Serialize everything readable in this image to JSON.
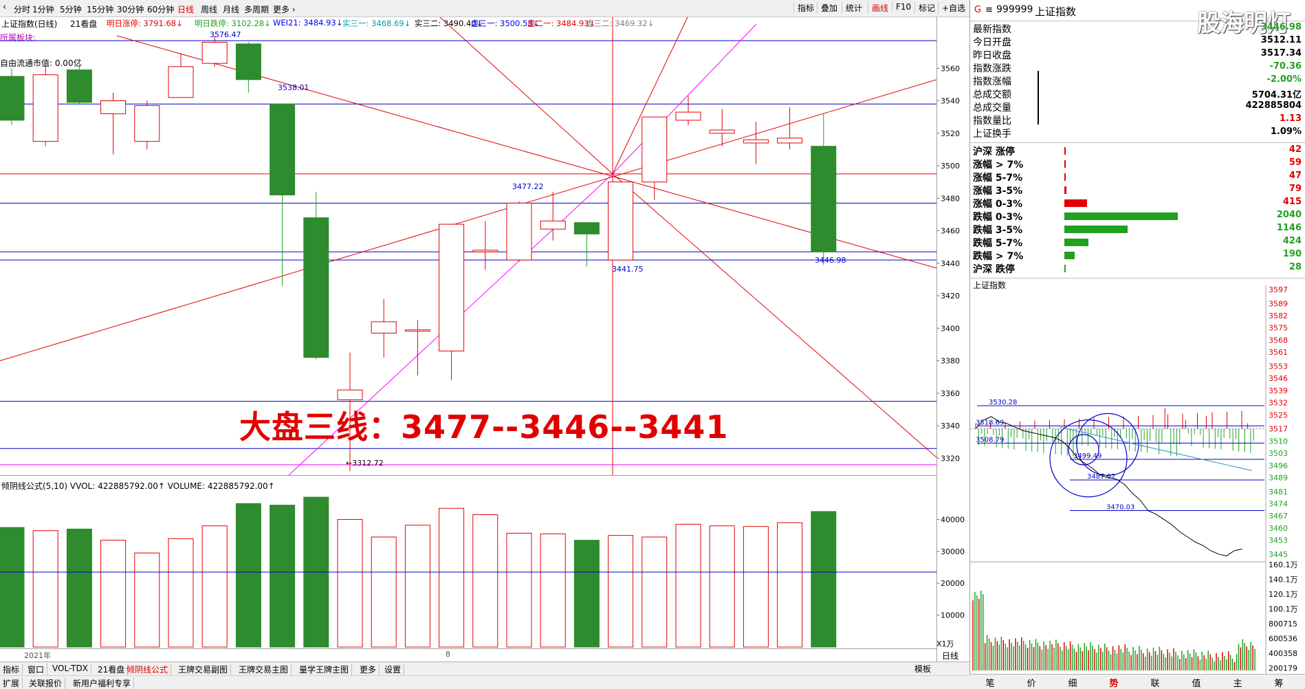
{
  "toolbar": {
    "periods": [
      "分时",
      "1分钟",
      "5分钟",
      "15分钟",
      "30分钟",
      "60分钟",
      "日线",
      "周线",
      "月线",
      "多周期",
      "更多 ›"
    ],
    "selected": "日线",
    "right_buttons": [
      "指标",
      "叠加",
      "统计",
      "画线",
      "F10",
      "标记",
      "+自选"
    ],
    "right_selected": "画线"
  },
  "info_line": {
    "title": "上证指数(日线)",
    "view": "21看盘",
    "items": [
      {
        "label": "明日涨停: 3791.68↓",
        "color": "#e00000"
      },
      {
        "label": "明日跌停: 3102.28↓",
        "color": "#22a022"
      },
      {
        "label": "WEI21: 3484.93↓",
        "color": "#0000ee"
      },
      {
        "label": "实三一: 3468.69↓",
        "color": "#00a0a0"
      },
      {
        "label": "实三二: 3490.40↓",
        "color": "#000000"
      },
      {
        "label": "虚三一: 3500.53↓",
        "color": "#0000ee"
      },
      {
        "label": "虚二一: 3484.93↓",
        "color": "#e00000"
      },
      {
        "label": "虚三二: 3469.32↓",
        "color": "#808080"
      }
    ]
  },
  "side_labels": {
    "block": "所属板块:",
    "float_value": "自由流通市值: 0.00亿"
  },
  "price_labels": {
    "high": "3576.47",
    "p1": "3538.01",
    "p2": "3477.22",
    "p3": "3441.75",
    "p4": "3446.98",
    "low": "←3312.72"
  },
  "headline": "大盘三线：3477--3446--3441",
  "chart_data": {
    "type": "candlestick",
    "title": "上证指数(日线)",
    "ylim": [
      3310,
      3580
    ],
    "y_ticks": [
      3320,
      3340,
      3360,
      3380,
      3400,
      3420,
      3440,
      3460,
      3480,
      3500,
      3520,
      3540,
      3560
    ],
    "candles": [
      {
        "o": 3555,
        "c": 3528,
        "h": 3560,
        "l": 3525
      },
      {
        "o": 3515,
        "c": 3556,
        "h": 3562,
        "l": 3512
      },
      {
        "o": 3559,
        "c": 3539,
        "h": 3566,
        "l": 3538
      },
      {
        "o": 3532,
        "c": 3540,
        "h": 3545,
        "l": 3507
      },
      {
        "o": 3515,
        "c": 3537,
        "h": 3540,
        "l": 3510
      },
      {
        "o": 3542,
        "c": 3561,
        "h": 3569,
        "l": 3542
      },
      {
        "o": 3563,
        "c": 3576,
        "h": 3580,
        "l": 3561
      },
      {
        "o": 3575,
        "c": 3553,
        "h": 3576,
        "l": 3545
      },
      {
        "o": 3538,
        "c": 3482,
        "h": 3538,
        "l": 3426
      },
      {
        "o": 3468,
        "c": 3382,
        "h": 3484,
        "l": 3381
      },
      {
        "o": 3356,
        "c": 3362,
        "h": 3385,
        "l": 3312
      },
      {
        "o": 3397,
        "c": 3404,
        "h": 3418,
        "l": 3382
      },
      {
        "o": 3399,
        "c": 3399,
        "h": 3405,
        "l": 3371
      },
      {
        "o": 3386,
        "c": 3464,
        "h": 3464,
        "l": 3368
      },
      {
        "o": 3447,
        "c": 3448,
        "h": 3466,
        "l": 3436
      },
      {
        "o": 3442,
        "c": 3477,
        "h": 3478,
        "l": 3441
      },
      {
        "o": 3461,
        "c": 3466,
        "h": 3484,
        "l": 3454
      },
      {
        "o": 3465,
        "c": 3458,
        "h": 3465,
        "l": 3438
      },
      {
        "o": 3442,
        "c": 3490,
        "h": 3491,
        "l": 3442
      },
      {
        "o": 3490,
        "c": 3530,
        "h": 3530,
        "l": 3479
      },
      {
        "o": 3528,
        "c": 3533,
        "h": 3543,
        "l": 3525
      },
      {
        "o": 3520,
        "c": 3522,
        "h": 3535,
        "l": 3512
      },
      {
        "o": 3514,
        "c": 3516,
        "h": 3527,
        "l": 3501
      },
      {
        "o": 3514,
        "c": 3517,
        "h": 3536,
        "l": 3510
      },
      {
        "o": 3512,
        "c": 3447,
        "h": 3532,
        "l": 3439
      }
    ],
    "horizontal_lines": [
      3577,
      3538,
      3495,
      3477,
      3447,
      3442,
      3355,
      3326,
      3316
    ],
    "volume": {
      "series_label": "倾阴线公式(5,10)  VVOL: 422885792.00↑  VOLUME: 422885792.00↑",
      "ylim": [
        0,
        45000
      ],
      "y_ticks": [
        10000,
        20000,
        30000,
        40000
      ],
      "unit_label": "X1万",
      "ma_level": 23500,
      "values": [
        37500,
        36500,
        37000,
        33500,
        29500,
        34000,
        38000,
        45000,
        44500,
        47000,
        40000,
        34500,
        38200,
        43500,
        41500,
        35700,
        35500,
        33500,
        35000,
        34500,
        38500,
        38000,
        37800,
        39000,
        42500
      ]
    },
    "x_label": "2021年",
    "x_marker": "8"
  },
  "quote": {
    "code": "999999",
    "name": "上证指数",
    "rows": [
      {
        "label": "最新指数",
        "value": "3446.98",
        "color": "#22a022"
      },
      {
        "label": "今日开盘",
        "value": "3512.11",
        "color": "#000000"
      },
      {
        "label": "昨日收盘",
        "value": "3517.34",
        "color": "#000000"
      },
      {
        "label": "指数涨跌",
        "value": "-70.36",
        "color": "#22a022"
      },
      {
        "label": "指数涨幅",
        "value": "-2.00%",
        "color": "#22a022"
      },
      {
        "label": "总成交额",
        "value": "5704.31亿",
        "color": "#000000"
      },
      {
        "label": "总成交量",
        "value": "422885804",
        "color": "#000000"
      },
      {
        "label": "指数量比",
        "value": "1.13",
        "color": "#e00000"
      },
      {
        "label": "上证换手",
        "value": "1.09%",
        "color": "#000000"
      }
    ],
    "breadth": [
      {
        "label": "沪深 涨停",
        "value": "42",
        "ratio": 0.01,
        "color": "#e00000"
      },
      {
        "label": "涨幅 > 7%",
        "value": "59",
        "ratio": 0.012,
        "color": "#e00000"
      },
      {
        "label": "涨幅 5-7%",
        "value": "47",
        "ratio": 0.01,
        "color": "#e00000"
      },
      {
        "label": "涨幅 3-5%",
        "value": "79",
        "ratio": 0.016,
        "color": "#e00000"
      },
      {
        "label": "涨幅 0-3%",
        "value": "415",
        "ratio": 0.2,
        "color": "#e00000"
      },
      {
        "label": "跌幅 0-3%",
        "value": "2040",
        "ratio": 1.0,
        "color": "#22a022"
      },
      {
        "label": "跌幅 3-5%",
        "value": "1146",
        "ratio": 0.56,
        "color": "#22a022"
      },
      {
        "label": "跌幅 5-7%",
        "value": "424",
        "ratio": 0.21,
        "color": "#22a022"
      },
      {
        "label": "跌幅 > 7%",
        "value": "190",
        "ratio": 0.09,
        "color": "#22a022"
      },
      {
        "label": "沪深 跌停",
        "value": "28",
        "ratio": 0.01,
        "color": "#22a022"
      }
    ]
  },
  "intraday": {
    "title": "上证指数",
    "price_ticks": [
      "3597",
      "3589",
      "3582",
      "3575",
      "3568",
      "3561",
      "3553",
      "3546",
      "3539",
      "3532",
      "3525",
      "3517",
      "3510",
      "3503",
      "3496",
      "3489",
      "3481",
      "3474",
      "3467",
      "3460",
      "3453",
      "3445"
    ],
    "vol_ticks": [
      "160.1万",
      "140.1万",
      "120.1万",
      "100.1万",
      "800715",
      "600536",
      "400358",
      "200179"
    ],
    "labels": [
      "3530.28",
      "3518.69",
      "3508.79",
      "3499.49",
      "3487.62",
      "3470.03"
    ],
    "price_series": [
      3517,
      3522,
      3524,
      3521,
      3520,
      3518,
      3516,
      3515,
      3514,
      3513,
      3512,
      3510,
      3506,
      3500,
      3497,
      3494,
      3490,
      3489,
      3488,
      3485,
      3480,
      3476,
      3470,
      3468,
      3465,
      3462,
      3458,
      3455,
      3452,
      3450,
      3447,
      3445,
      3444,
      3447,
      3448
    ]
  },
  "watermark": "股海明灯",
  "bottom_tabs": [
    "指标",
    "窗口",
    "VOL-TDX",
    "21看盘",
    "倾阴线公式",
    "王牌交易副图",
    "王牌交易主图",
    "量学王牌主图",
    "更多",
    "设置"
  ],
  "bottom_selected": "倾阴线公式",
  "bottom_right": "模板",
  "bottom_tabs2": [
    "扩展",
    "关联报价",
    "新用户福利专享"
  ],
  "right_axis_footer": "日线",
  "right_tabs": [
    "笔",
    "价",
    "细",
    "势",
    "联",
    "值",
    "主",
    "筹"
  ],
  "right_selected": "势"
}
